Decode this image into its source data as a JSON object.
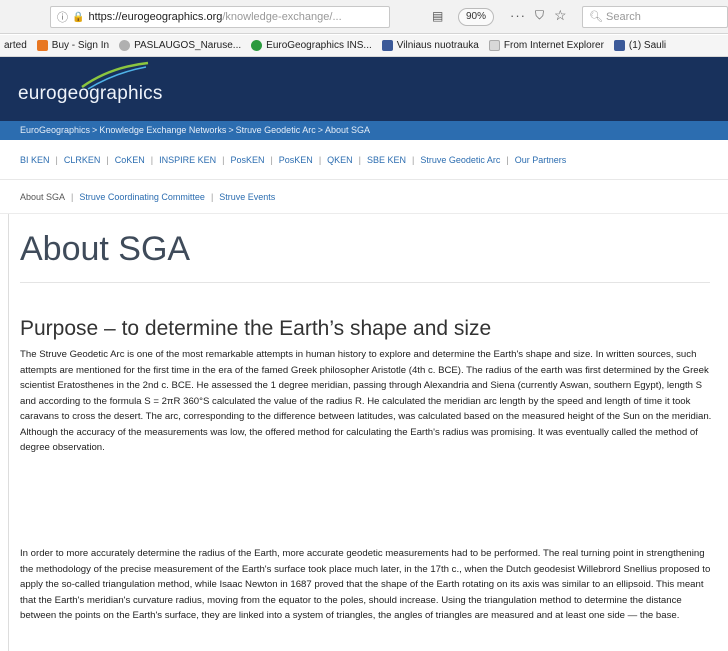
{
  "browser": {
    "url_domain": "https://eurogeographics.org",
    "url_rest": "/knowledge-exchange/...",
    "zoom": "90%",
    "search_placeholder": "Search",
    "bookmarks": [
      {
        "label": "arted",
        "color": ""
      },
      {
        "label": "Buy - Sign In",
        "color": "#e87722"
      },
      {
        "label": "PASLAUGOS_Naruse...",
        "color": "#b0b0b0"
      },
      {
        "label": "EuroGeographics INS...",
        "color": "#2b9a3e"
      },
      {
        "label": "Vilniaus nuotrauka",
        "color": "#3b5998"
      },
      {
        "label": "From Internet Explorer",
        "color": "#d8d8d8"
      },
      {
        "label": "(1) Sauli",
        "color": "#3b5998"
      }
    ]
  },
  "site": {
    "logo_text": "eurogeographics",
    "breadcrumb": [
      "EuroGeographics",
      "Knowledge Exchange Networks",
      "Struve Geodetic Arc",
      "About SGA"
    ],
    "nav_primary": [
      "BI KEN",
      "CLRKEN",
      "CoKEN",
      "INSPIRE KEN",
      "PosKEN",
      "PosKEN",
      "QKEN",
      "SBE KEN",
      "Struve Geodetic Arc",
      "Our Partners"
    ],
    "nav_secondary": [
      "About SGA",
      "Struve Coordinating Committee",
      "Struve Events"
    ]
  },
  "content": {
    "page_title": "About SGA",
    "section_heading": "Purpose – to determine the Earth’s shape and size",
    "paragraph_1": "The Struve Geodetic Arc is one of the most remarkable attempts in human history to explore and determine the Earth's shape and size. In written sources, such attempts are mentioned for the first time in the era of the famed Greek philosopher Aristotle (4th c. BCE). The radius of the earth was first determined by the Greek scientist Eratosthenes in the 2nd c. BCE. He assessed the 1 degree meridian, passing through Alexandria and Siena (currently Aswan, southern Egypt), length S and according to the formula S = 2πR 360°S calculated the value of the radius R. He calculated the meridian arc length by the speed and length of time it took caravans to cross the desert. The arc, corresponding to the difference between latitudes, was calculated based on the measured height of the Sun on the meridian. Although the accuracy of the measurements was low, the offered method for calculating the Earth's radius was promising. It was eventually called the method of degree observation.",
    "paragraph_2": "In order to more accurately determine the radius of the Earth, more accurate geodetic measurements had to be performed. The real turning point in strengthening the methodology of the precise measurement of the Earth's surface took place much later, in the 17th c., when the Dutch geodesist Willebrord Snellius proposed to apply the so-called triangulation method, while Isaac Newton in 1687 proved that the shape of the Earth rotating on its axis was similar to an ellipsoid. This meant that the Earth's meridian's curvature radius, moving from the equator to the poles, should increase. Using the triangulation method to determine the distance between the points on the Earth's surface, they are linked into a system of triangles, the angles of triangles are measured and at least one side — the base."
  },
  "colors": {
    "header_bg": "#18315c",
    "breadcrumb_bg": "#2c6db0",
    "link": "#2c6db0"
  }
}
